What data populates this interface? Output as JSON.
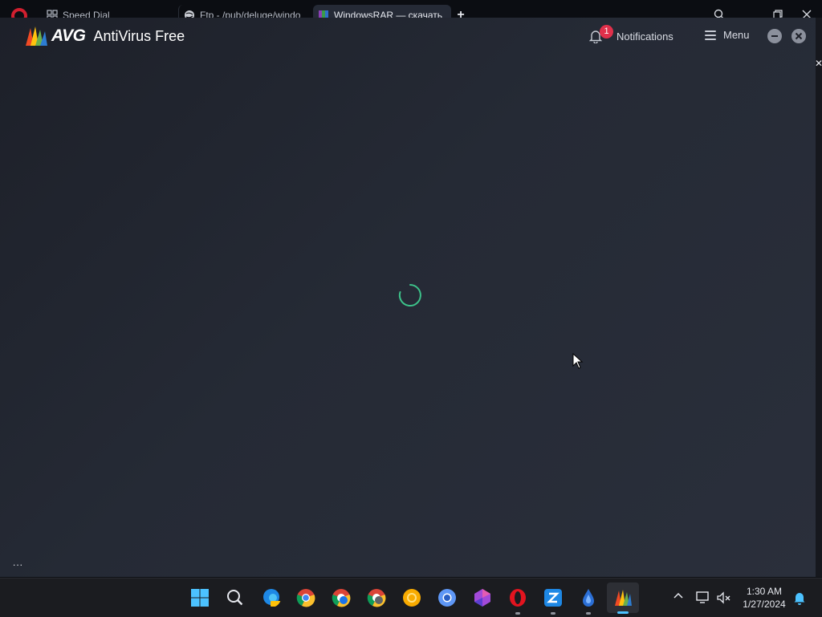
{
  "browser": {
    "tabs": [
      {
        "label": "Speed Dial",
        "icon": "grid-icon"
      },
      {
        "label": "Ftp - /pub/deluge/windo",
        "icon": "globe-icon"
      },
      {
        "label": "WindowsRAR — скачать",
        "icon": "winrar-icon",
        "active": true
      }
    ],
    "new_tab_label": "+"
  },
  "avg": {
    "brand": "AVG",
    "product": "AntiVirus Free",
    "notifications_label": "Notifications",
    "notifications_count": "1",
    "menu_label": "Menu",
    "status": "loading",
    "footer_dots": "..."
  },
  "taskbar": {
    "apps": [
      "start-icon",
      "search-icon",
      "edge-beta-icon",
      "chrome-icon",
      "chrome-beta-icon",
      "chrome-dev-icon",
      "chrome-canary-icon",
      "chromium-icon",
      "gem-app-icon",
      "opera-icon",
      "zoom-icon",
      "deluge-icon",
      "avg-icon"
    ],
    "time": "1:30 AM",
    "date": "1/27/2024"
  },
  "colors": {
    "avg_bg": "#252a35",
    "badge": "#e0304b",
    "spinner": "#3dc28a",
    "taskbar_accent": "#4cc2ff"
  }
}
